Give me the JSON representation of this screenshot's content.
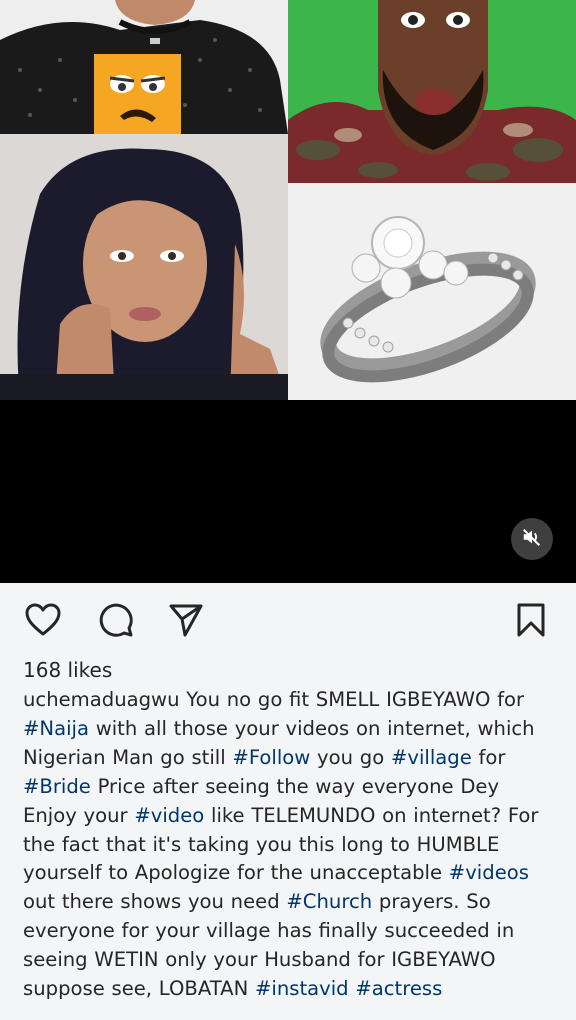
{
  "post": {
    "likes": "168 likes",
    "username": "uchemaduagwu",
    "caption": [
      {
        "t": "text",
        "v": " You no go fit SMELL IGBEYAWO for "
      },
      {
        "t": "tag",
        "v": "#Naija"
      },
      {
        "t": "text",
        "v": " with all those your videos on internet, which Nigerian Man go still "
      },
      {
        "t": "tag",
        "v": "#Follow"
      },
      {
        "t": "text",
        "v": " you go "
      },
      {
        "t": "tag",
        "v": "#village"
      },
      {
        "t": "text",
        "v": " for "
      },
      {
        "t": "tag",
        "v": "#Bride"
      },
      {
        "t": "text",
        "v": " Price after seeing the way everyone Dey Enjoy your "
      },
      {
        "t": "tag",
        "v": "#video"
      },
      {
        "t": "text",
        "v": " like TELEMUNDO on internet? For the fact that it's taking you this long to HUMBLE yourself to Apologize for the unacceptable "
      },
      {
        "t": "tag",
        "v": "#videos"
      },
      {
        "t": "text",
        "v": " out there shows you need "
      },
      {
        "t": "tag",
        "v": "#Church"
      },
      {
        "t": "text",
        "v": " prayers. So everyone for your village has finally succeeded in seeing WETIN only your Husband for IGBEYAWO suppose see, LOBATAN "
      },
      {
        "t": "tag",
        "v": "#instavid"
      },
      {
        "t": "text",
        "v": " "
      },
      {
        "t": "tag",
        "v": "#actress"
      }
    ]
  },
  "icons": {
    "like": "heart-icon",
    "comment": "comment-icon",
    "share": "send-icon",
    "save": "bookmark-icon",
    "mute": "volume-muted-icon"
  },
  "colors": {
    "hashtag": "#00376b",
    "text": "#262626",
    "background": "#f4f5f7",
    "video_bg": "#000000"
  }
}
